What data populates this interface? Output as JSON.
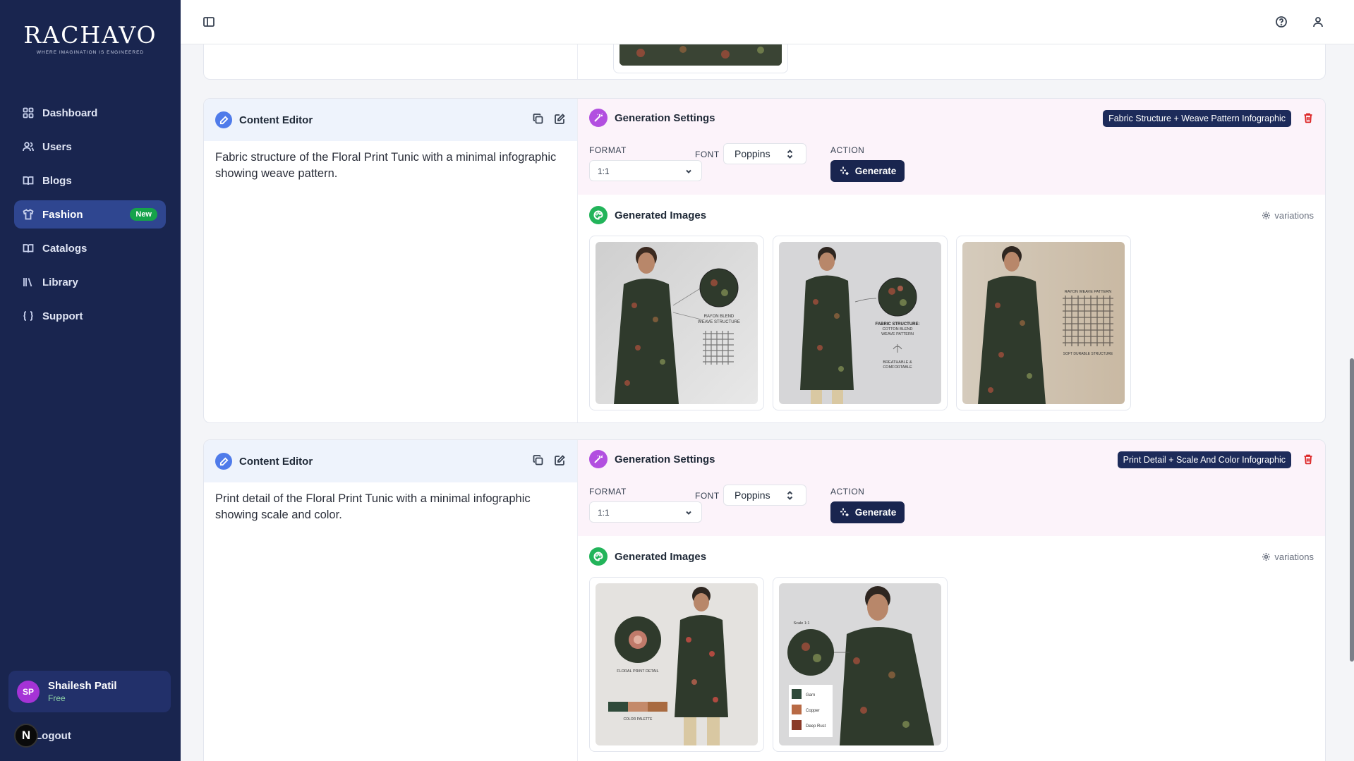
{
  "brand": {
    "name": "RACHAVO",
    "tagline": "WHERE IMAGINATION IS ENGINEERED"
  },
  "sidebar": {
    "items": [
      {
        "label": "Dashboard",
        "icon": "dashboard-icon"
      },
      {
        "label": "Users",
        "icon": "users-icon"
      },
      {
        "label": "Blogs",
        "icon": "book-icon"
      },
      {
        "label": "Fashion",
        "icon": "shirt-icon",
        "badge": "New",
        "active": true
      },
      {
        "label": "Catalogs",
        "icon": "catalog-icon"
      },
      {
        "label": "Library",
        "icon": "library-icon"
      },
      {
        "label": "Support",
        "icon": "braces-icon"
      }
    ],
    "user": {
      "initials": "SP",
      "name": "Shailesh Patil",
      "plan": "Free"
    },
    "logout_label": "Logout",
    "n_badge": "N"
  },
  "topbar": {
    "icons": [
      "sidebar-toggle-icon",
      "help-icon",
      "user-icon"
    ]
  },
  "cards": [
    {
      "editor_title": "Content Editor",
      "editor_text": "Fabric structure of the Floral Print Tunic with a minimal infographic showing weave pattern.",
      "settings_title": "Generation Settings",
      "tag": "Fabric Structure + Weave Pattern Infographic",
      "format_label": "FORMAT",
      "format_value": "1:1",
      "font_label": "FONT",
      "font_value": "Poppins",
      "action_label": "ACTION",
      "generate_label": "Generate",
      "images_title": "Generated Images",
      "variations_label": "variations",
      "images": [
        {
          "texts": [
            "RAYON BLEND",
            "WEAVE STRUCTURE"
          ]
        },
        {
          "texts": [
            "FABRIC STRUCTURE:",
            "COTTON BLEND",
            "WEAVE PATTERN",
            "BREATHABLE &",
            "COMFORTABLE"
          ]
        },
        {
          "texts": [
            "RAYON WEAVE PATTERN",
            "SOFT DURABLE STRUCTURE"
          ]
        }
      ]
    },
    {
      "editor_title": "Content Editor",
      "editor_text": "Print detail of the Floral Print Tunic with a minimal infographic showing scale and color.",
      "settings_title": "Generation Settings",
      "tag": "Print Detail + Scale And Color Infographic",
      "format_label": "FORMAT",
      "format_value": "1:1",
      "font_label": "FONT",
      "font_value": "Poppins",
      "action_label": "ACTION",
      "generate_label": "Generate",
      "images_title": "Generated Images",
      "variations_label": "variations",
      "images": [
        {
          "texts": [
            "FLORAL PRINT DETAIL",
            "COLOR PALETTE"
          ]
        },
        {
          "texts": [
            "Scale 1:1",
            "Garn",
            "Copper",
            "Deep Rust"
          ]
        }
      ]
    }
  ],
  "colors": {
    "sidebar": "#19254f",
    "accent": "#2f4690",
    "badge_green": "#16a34a",
    "tag_navy": "#1d2b5a",
    "trash_red": "#dc2626",
    "tunic_green": "#2f3a2c"
  }
}
